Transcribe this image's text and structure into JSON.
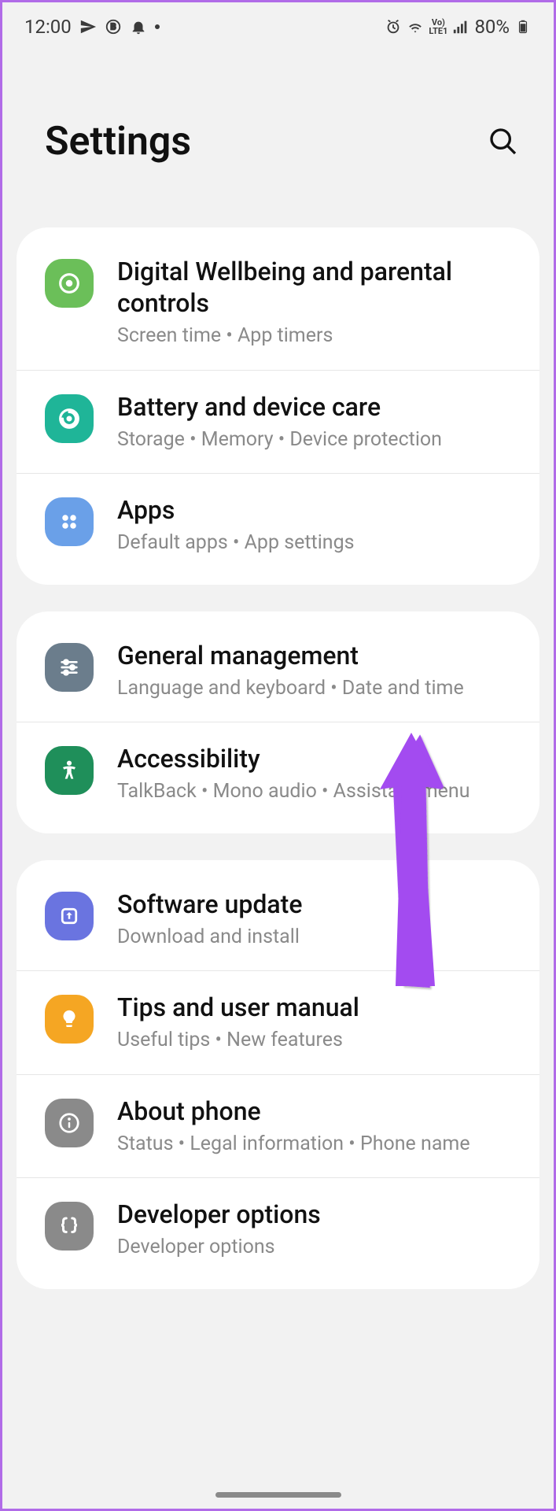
{
  "status": {
    "time": "12:00",
    "battery": "80%"
  },
  "header": {
    "title": "Settings"
  },
  "groups": [
    {
      "items": [
        {
          "id": "digital-wellbeing",
          "title": "Digital Wellbeing and parental controls",
          "sub": "Screen time  •  App timers",
          "color": "#6bbf59"
        },
        {
          "id": "battery-care",
          "title": "Battery and device care",
          "sub": "Storage  •  Memory  •  Device protection",
          "color": "#1fb598"
        },
        {
          "id": "apps",
          "title": "Apps",
          "sub": "Default apps  •  App settings",
          "color": "#6aa0e8"
        }
      ]
    },
    {
      "items": [
        {
          "id": "general-management",
          "title": "General management",
          "sub": "Language and keyboard  •  Date and time",
          "color": "#6b7d8c"
        },
        {
          "id": "accessibility",
          "title": "Accessibility",
          "sub": "TalkBack  •  Mono audio  •  Assistant menu",
          "color": "#1f8f5a"
        }
      ]
    },
    {
      "items": [
        {
          "id": "software-update",
          "title": "Software update",
          "sub": "Download and install",
          "color": "#6a74e0"
        },
        {
          "id": "tips",
          "title": "Tips and user manual",
          "sub": "Useful tips  •  New features",
          "color": "#f5a623"
        },
        {
          "id": "about-phone",
          "title": "About phone",
          "sub": "Status  •  Legal information  •  Phone name",
          "color": "#8a8a8a"
        },
        {
          "id": "developer-options",
          "title": "Developer options",
          "sub": "Developer options",
          "color": "#8a8a8a"
        }
      ]
    }
  ]
}
